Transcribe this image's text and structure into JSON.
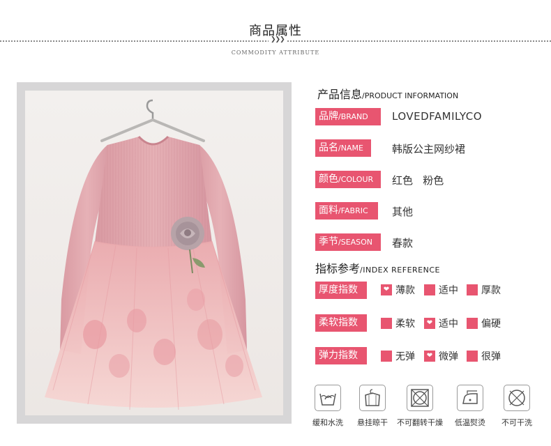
{
  "header": {
    "title": "商品属性",
    "subtitle": "COMMODITY ATTRIBUTE",
    "arrows": "❯❯❯"
  },
  "product_info": {
    "title_cn": "产品信息",
    "title_en": "/PRODUCT INFORMATION",
    "rows": [
      {
        "label_cn": "品牌",
        "label_en": "/BRAND",
        "value": "LOVEDFAMILYCO"
      },
      {
        "label_cn": "品名",
        "label_en": "/NAME",
        "value": "韩版公主网纱裙"
      },
      {
        "label_cn": "颜色",
        "label_en": "/COLOUR",
        "value": "红色   粉色"
      },
      {
        "label_cn": "面料",
        "label_en": "/FABRIC",
        "value": "其他"
      },
      {
        "label_cn": "季节",
        "label_en": "/SEASON",
        "value": "春款"
      }
    ]
  },
  "index_reference": {
    "title_cn": "指标参考",
    "title_en": "/INDEX REFERENCE",
    "rows": [
      {
        "label": "厚度指数",
        "options": [
          {
            "text": "薄款",
            "selected": true
          },
          {
            "text": "适中",
            "selected": false
          },
          {
            "text": "厚款",
            "selected": false
          }
        ]
      },
      {
        "label": "柔软指数",
        "options": [
          {
            "text": "柔软",
            "selected": false
          },
          {
            "text": "适中",
            "selected": true
          },
          {
            "text": "偏硬",
            "selected": false
          }
        ]
      },
      {
        "label": "弹力指数",
        "options": [
          {
            "text": "无弹",
            "selected": false
          },
          {
            "text": "微弹",
            "selected": true
          },
          {
            "text": "很弹",
            "selected": false
          }
        ]
      }
    ]
  },
  "care": [
    {
      "icon": "hand-wash-icon",
      "label": "缓和水洗"
    },
    {
      "icon": "hang-dry-icon",
      "label": "悬挂晾干"
    },
    {
      "icon": "no-tumble-dry-icon",
      "label": "不可翻转干燥"
    },
    {
      "icon": "low-iron-icon",
      "label": "低温熨烫"
    },
    {
      "icon": "no-dry-clean-icon",
      "label": "不可干洗"
    }
  ],
  "colors": {
    "accent": "#e85570",
    "pink_dress": "#e2aab0",
    "tulle": "#f4cdcc"
  },
  "selected_marker": "❤"
}
